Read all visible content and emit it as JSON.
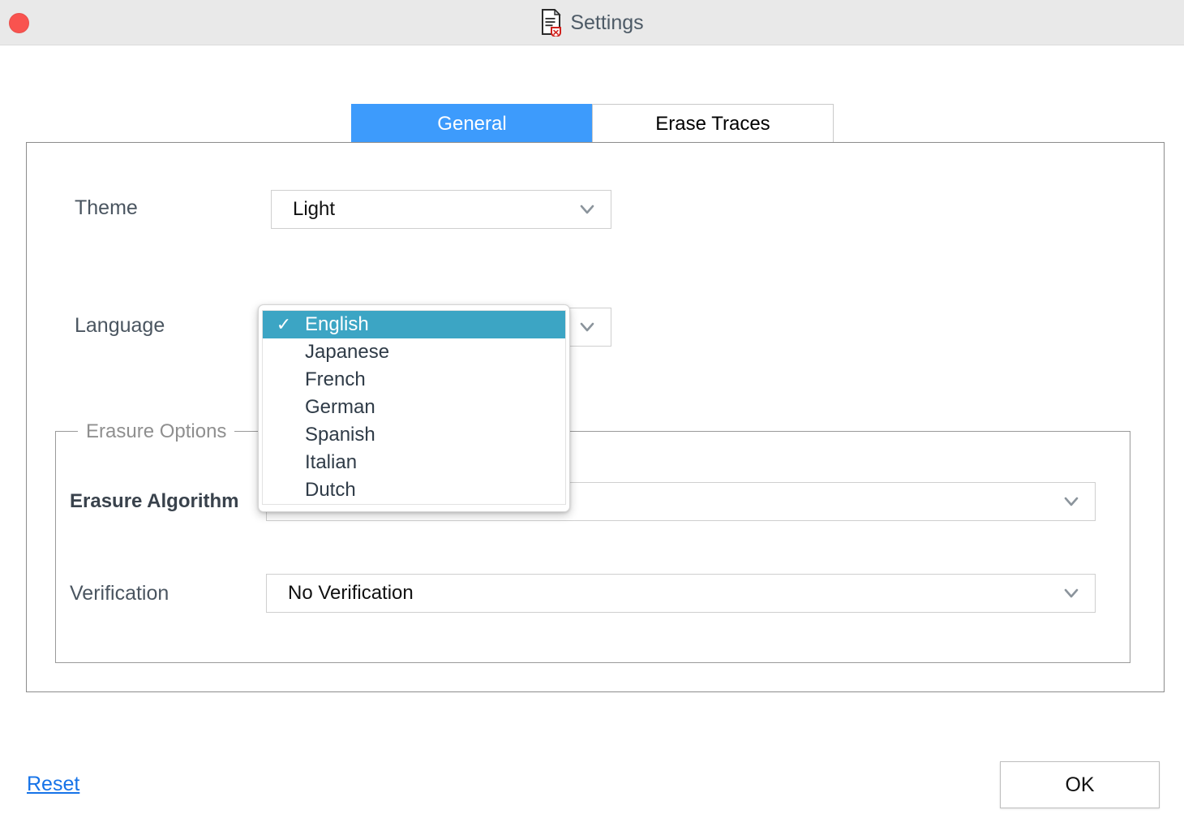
{
  "window": {
    "title": "Settings",
    "title_icon": "document-shield-icon",
    "close_button": "close-window-button",
    "titlebar_bg": "#e9e9e9"
  },
  "tabs": [
    {
      "label": "General",
      "active": true
    },
    {
      "label": "Erase Traces",
      "active": false
    }
  ],
  "colors": {
    "tab_active_bg": "#3d9bfc",
    "menu_highlight": "#3ca5c4",
    "link": "#1673e8",
    "close_dot": "#f9534f"
  },
  "general": {
    "theme": {
      "label": "Theme",
      "value": "Light",
      "chevron": "chevron-down-icon"
    },
    "language": {
      "label": "Language",
      "value": "English",
      "chevron": "chevron-down-icon",
      "options": [
        {
          "label": "English",
          "selected": true
        },
        {
          "label": "Japanese",
          "selected": false
        },
        {
          "label": "French",
          "selected": false
        },
        {
          "label": "German",
          "selected": false
        },
        {
          "label": "Spanish",
          "selected": false
        },
        {
          "label": "Italian",
          "selected": false
        },
        {
          "label": "Dutch",
          "selected": false
        }
      ],
      "check_glyph": "✓"
    }
  },
  "erasure_options": {
    "legend": "Erasure Options",
    "algorithm": {
      "label": "Erasure Algorithm",
      "value": "",
      "chevron": "chevron-down-icon"
    },
    "verification": {
      "label": "Verification",
      "value": "No Verification",
      "chevron": "chevron-down-icon"
    }
  },
  "footer": {
    "reset_label": "Reset",
    "ok_label": "OK"
  }
}
